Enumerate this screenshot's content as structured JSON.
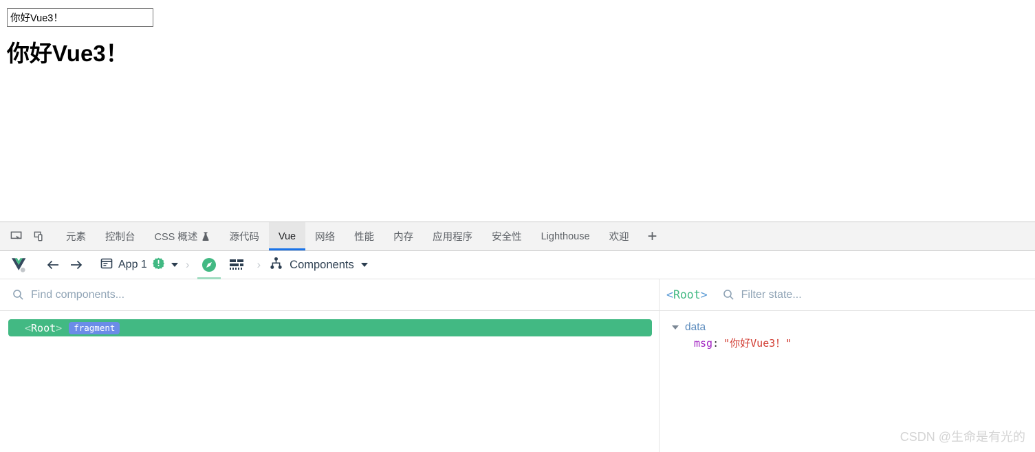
{
  "page": {
    "input_value": "你好Vue3！",
    "heading": "你好Vue3！"
  },
  "devtools": {
    "tools": [
      {
        "name": "inspect-element-icon",
        "label": ""
      },
      {
        "name": "device-toolbar-icon",
        "label": ""
      }
    ],
    "tabs": [
      {
        "label": "元素",
        "active": false,
        "experimental": false
      },
      {
        "label": "控制台",
        "active": false,
        "experimental": false
      },
      {
        "label": "CSS 概述",
        "active": false,
        "experimental": true
      },
      {
        "label": "源代码",
        "active": false,
        "experimental": false
      },
      {
        "label": "Vue",
        "active": true,
        "experimental": false
      },
      {
        "label": "网络",
        "active": false,
        "experimental": false
      },
      {
        "label": "性能",
        "active": false,
        "experimental": false
      },
      {
        "label": "内存",
        "active": false,
        "experimental": false
      },
      {
        "label": "应用程序",
        "active": false,
        "experimental": false
      },
      {
        "label": "安全性",
        "active": false,
        "experimental": false
      },
      {
        "label": "Lighthouse",
        "active": false,
        "experimental": false
      },
      {
        "label": "欢迎",
        "active": false,
        "experimental": false
      }
    ],
    "add_tab_label": "+"
  },
  "vue_toolbar": {
    "app_label": "App 1",
    "view_label": "Components",
    "icons": {
      "logo": "vue-logo-icon",
      "back": "back-arrow-icon",
      "forward": "forward-arrow-icon",
      "app": "app-window-icon",
      "badge": "green-alert-badge-icon",
      "inspector": "compass-inspector-icon",
      "timeline": "timeline-icon",
      "components": "component-tree-icon"
    }
  },
  "components_pane": {
    "search_placeholder": "Find components...",
    "search_value": "",
    "tree": [
      {
        "name": "<Root>",
        "name_open": "<",
        "name_text": "Root",
        "name_close": ">",
        "tag": "fragment",
        "selected": true
      }
    ]
  },
  "state_pane": {
    "selected_component_open": "<",
    "selected_component_name": "Root",
    "selected_component_close": ">",
    "filter_placeholder": "Filter state...",
    "filter_value": "",
    "groups": [
      {
        "label": "data",
        "expanded": true,
        "items": [
          {
            "key": "msg",
            "colon": ":",
            "value": "\"你好Vue3！\""
          }
        ]
      }
    ]
  },
  "watermark": {
    "text": "CSDN @生命是有光的"
  },
  "colors": {
    "vue_green": "#42b983",
    "tag_blue": "#6b8ce8",
    "tab_active_underline": "#1a73e8",
    "state_key_purple": "#a020c0",
    "state_value_red": "#d13a30"
  }
}
